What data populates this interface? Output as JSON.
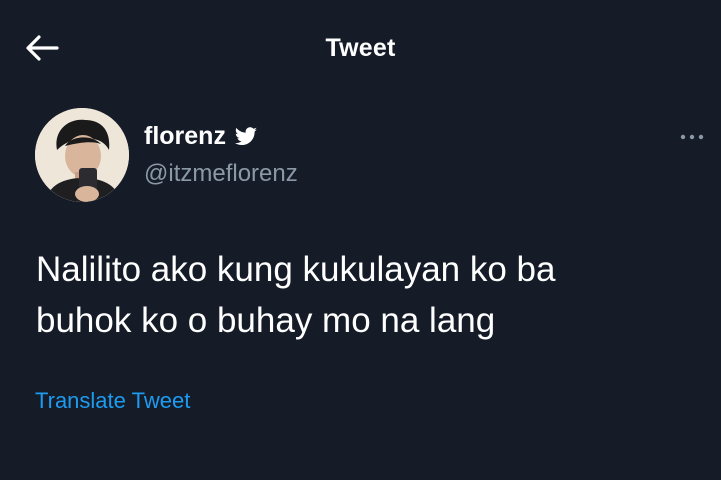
{
  "header": {
    "title": "Tweet",
    "back_icon": "arrow-left-icon"
  },
  "author": {
    "display_name": "florenz",
    "handle": "@itzmeflorenz",
    "verified": true,
    "verified_icon": "twitter-bird-icon"
  },
  "tweet": {
    "lines": [
      "Nalilito ako kung kukulayan ko ba",
      "buhok ko o buhay mo na lang"
    ]
  },
  "translate_label": "Translate Tweet",
  "more_icon": "more-options-icon",
  "colors": {
    "background": "#151c28",
    "text": "#ffffff",
    "secondary": "#8b98a5",
    "link": "#1d9bf0"
  }
}
